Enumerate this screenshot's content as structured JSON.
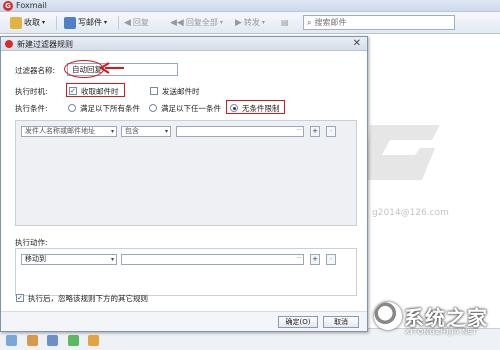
{
  "app": {
    "title": "Foxmail"
  },
  "toolbar": {
    "receive_label": "收取",
    "compose_label": "写邮件",
    "reply_label": "回复",
    "reply_all_label": "回复全部",
    "forward_label": "转发",
    "search_placeholder": "搜索邮件"
  },
  "background": {
    "email_fragment": "g2014@126.com"
  },
  "dialog": {
    "title": "新建过滤器规则",
    "filter_name_label": "过滤器名称:",
    "filter_name_value": "自动回复",
    "exec_time_label": "执行时机:",
    "on_receive_label": "收取邮件时",
    "on_receive_checked": true,
    "on_send_label": "发送邮件时",
    "on_send_checked": false,
    "condition_label": "执行条件:",
    "cond_all_label": "满足以下所有条件",
    "cond_any_label": "满足以下任一条件",
    "cond_none_label": "无条件限制",
    "cond_selected": "无条件限制",
    "condition_field_value": "发件人名称或邮件地址",
    "condition_op_value": "包含",
    "action_label": "执行动作:",
    "action_value": "移动到",
    "stop_rules_label": "执行后，忽略该规则下方的其它规则",
    "stop_rules_checked": true,
    "ok_label": "确定(O)",
    "cancel_label": "取消",
    "dots": "···",
    "plus": "+",
    "minus": "-"
  },
  "watermark": {
    "text": "系统之家",
    "sub": "XITONGZHIJIA.NET"
  },
  "colors": {
    "accent_red": "#d61a1a",
    "app_red": "#d62c2c",
    "dialog_border": "#7f93ad"
  }
}
